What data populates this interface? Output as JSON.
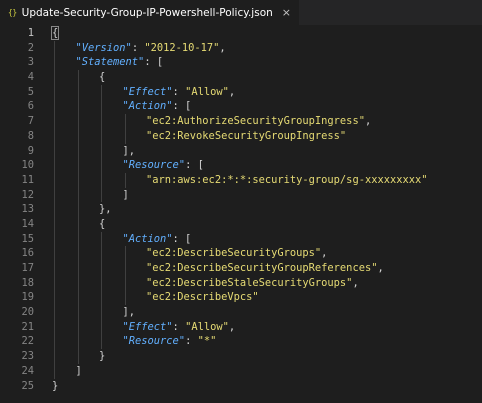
{
  "tab": {
    "icon": "{}",
    "title": "Update-Security-Group-IP-Powershell-Policy.json",
    "close": "×"
  },
  "editor": {
    "current_line": 1,
    "lines": [
      {
        "num": "1",
        "indent": 0,
        "tokens": [
          {
            "t": "p",
            "v": "{"
          }
        ]
      },
      {
        "num": "2",
        "indent": 1,
        "tokens": [
          {
            "t": "k",
            "v": "\"Version\""
          },
          {
            "t": "p",
            "v": ": "
          },
          {
            "t": "s",
            "v": "\"2012-10-17\""
          },
          {
            "t": "p",
            "v": ","
          }
        ]
      },
      {
        "num": "3",
        "indent": 1,
        "tokens": [
          {
            "t": "k",
            "v": "\"Statement\""
          },
          {
            "t": "p",
            "v": ": ["
          }
        ]
      },
      {
        "num": "4",
        "indent": 2,
        "tokens": [
          {
            "t": "p",
            "v": "{"
          }
        ]
      },
      {
        "num": "5",
        "indent": 3,
        "tokens": [
          {
            "t": "k",
            "v": "\"Effect\""
          },
          {
            "t": "p",
            "v": ": "
          },
          {
            "t": "s",
            "v": "\"Allow\""
          },
          {
            "t": "p",
            "v": ","
          }
        ]
      },
      {
        "num": "6",
        "indent": 3,
        "tokens": [
          {
            "t": "k",
            "v": "\"Action\""
          },
          {
            "t": "p",
            "v": ": ["
          }
        ]
      },
      {
        "num": "7",
        "indent": 4,
        "tokens": [
          {
            "t": "s",
            "v": "\"ec2:AuthorizeSecurityGroupIngress\""
          },
          {
            "t": "p",
            "v": ","
          }
        ]
      },
      {
        "num": "8",
        "indent": 4,
        "tokens": [
          {
            "t": "s",
            "v": "\"ec2:RevokeSecurityGroupIngress\""
          }
        ]
      },
      {
        "num": "9",
        "indent": 3,
        "tokens": [
          {
            "t": "p",
            "v": "],"
          }
        ]
      },
      {
        "num": "10",
        "indent": 3,
        "tokens": [
          {
            "t": "k",
            "v": "\"Resource\""
          },
          {
            "t": "p",
            "v": ": ["
          }
        ]
      },
      {
        "num": "11",
        "indent": 4,
        "tokens": [
          {
            "t": "s",
            "v": "\"arn:aws:ec2:*:*:security-group/sg-xxxxxxxxx\""
          }
        ]
      },
      {
        "num": "12",
        "indent": 3,
        "tokens": [
          {
            "t": "p",
            "v": "]"
          }
        ]
      },
      {
        "num": "13",
        "indent": 2,
        "tokens": [
          {
            "t": "p",
            "v": "},"
          }
        ]
      },
      {
        "num": "14",
        "indent": 2,
        "tokens": [
          {
            "t": "p",
            "v": "{"
          }
        ]
      },
      {
        "num": "15",
        "indent": 3,
        "tokens": [
          {
            "t": "k",
            "v": "\"Action\""
          },
          {
            "t": "p",
            "v": ": ["
          }
        ]
      },
      {
        "num": "16",
        "indent": 4,
        "tokens": [
          {
            "t": "s",
            "v": "\"ec2:DescribeSecurityGroups\""
          },
          {
            "t": "p",
            "v": ","
          }
        ]
      },
      {
        "num": "17",
        "indent": 4,
        "tokens": [
          {
            "t": "s",
            "v": "\"ec2:DescribeSecurityGroupReferences\""
          },
          {
            "t": "p",
            "v": ","
          }
        ]
      },
      {
        "num": "18",
        "indent": 4,
        "tokens": [
          {
            "t": "s",
            "v": "\"ec2:DescribeStaleSecurityGroups\""
          },
          {
            "t": "p",
            "v": ","
          }
        ]
      },
      {
        "num": "19",
        "indent": 4,
        "tokens": [
          {
            "t": "s",
            "v": "\"ec2:DescribeVpcs\""
          }
        ]
      },
      {
        "num": "20",
        "indent": 3,
        "tokens": [
          {
            "t": "p",
            "v": "],"
          }
        ]
      },
      {
        "num": "21",
        "indent": 3,
        "tokens": [
          {
            "t": "k",
            "v": "\"Effect\""
          },
          {
            "t": "p",
            "v": ": "
          },
          {
            "t": "s",
            "v": "\"Allow\""
          },
          {
            "t": "p",
            "v": ","
          }
        ]
      },
      {
        "num": "22",
        "indent": 3,
        "tokens": [
          {
            "t": "k",
            "v": "\"Resource\""
          },
          {
            "t": "p",
            "v": ": "
          },
          {
            "t": "s",
            "v": "\"*\""
          }
        ]
      },
      {
        "num": "23",
        "indent": 2,
        "tokens": [
          {
            "t": "p",
            "v": "}"
          }
        ]
      },
      {
        "num": "24",
        "indent": 1,
        "tokens": [
          {
            "t": "p",
            "v": "]"
          }
        ]
      },
      {
        "num": "25",
        "indent": 0,
        "tokens": [
          {
            "t": "p",
            "v": "}"
          }
        ]
      }
    ]
  },
  "colors": {
    "background": "#1e1e1e",
    "key": "#62b0ff",
    "string": "#e6db74",
    "punctuation": "#d4d4d4",
    "line_number": "#858585"
  }
}
